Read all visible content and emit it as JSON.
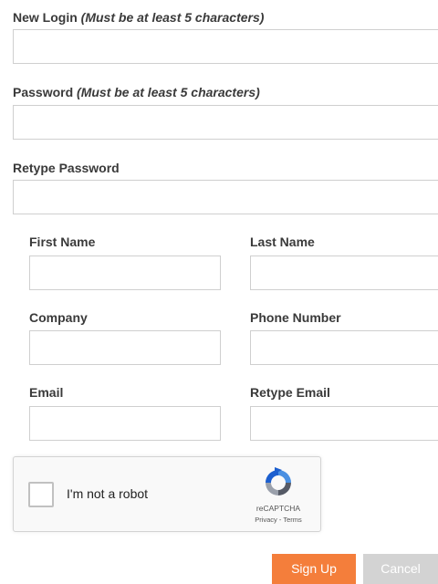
{
  "form": {
    "login": {
      "label": "New Login",
      "hint": "(Must be at least 5 characters)",
      "value": ""
    },
    "password": {
      "label": "Password",
      "hint": "(Must be at least 5 characters)",
      "value": ""
    },
    "retype_password": {
      "label": "Retype Password",
      "value": ""
    },
    "first_name": {
      "label": "First Name",
      "value": ""
    },
    "last_name": {
      "label": "Last Name",
      "value": ""
    },
    "company": {
      "label": "Company",
      "value": ""
    },
    "phone": {
      "label": "Phone Number",
      "value": ""
    },
    "email": {
      "label": "Email",
      "value": ""
    },
    "retype_email": {
      "label": "Retype Email",
      "value": ""
    }
  },
  "captcha": {
    "label": "I'm not a robot",
    "brand": "reCAPTCHA",
    "privacy": "Privacy",
    "separator": " - ",
    "terms": "Terms",
    "checked": false
  },
  "buttons": {
    "signup": "Sign Up",
    "cancel": "Cancel"
  },
  "colors": {
    "signup_bg": "#f47e3b",
    "cancel_bg": "#d3d3d3",
    "field_border": "#cfcfcf"
  }
}
